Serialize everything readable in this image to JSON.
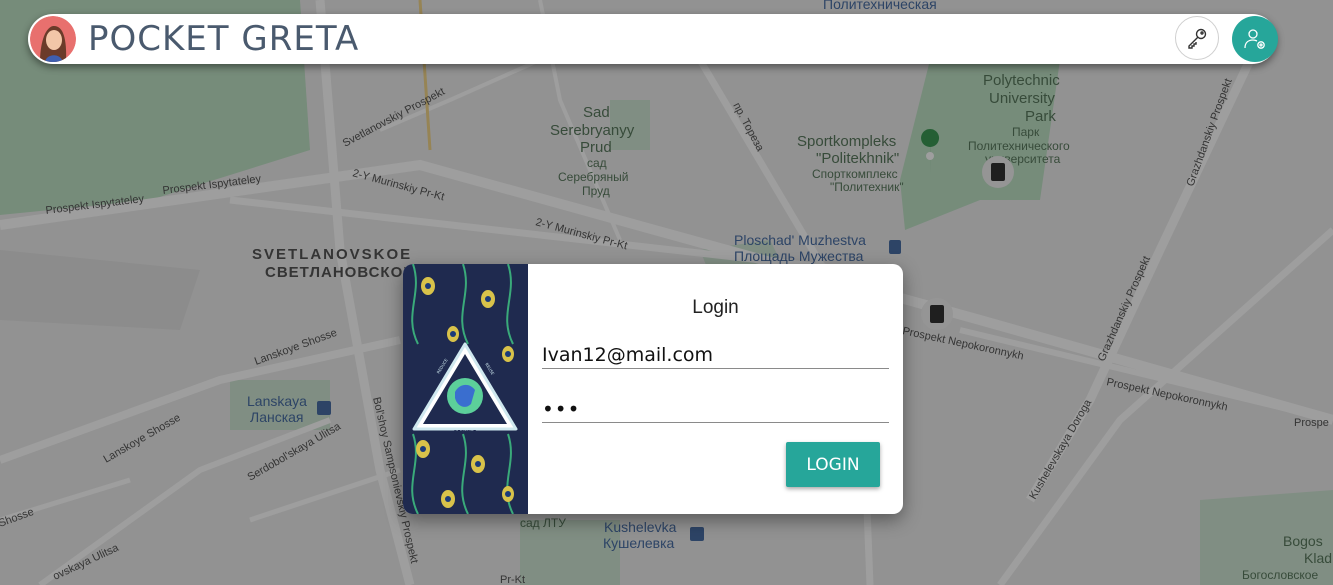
{
  "app": {
    "title": "POCKET GRETA"
  },
  "topbar": {
    "avatar_icon": "user-avatar",
    "key_icon": "key-icon",
    "user_icon": "user-settings-icon",
    "accent": "#26a69a"
  },
  "map": {
    "labels": [
      "Политехническая",
      "Polytechnic",
      "University",
      "Park",
      "Парк",
      "Политехнического",
      "университета",
      "Sad",
      "Serebryanyy",
      "Prud",
      "сад",
      "Серебряный",
      "Пруд",
      "Sportkompleks",
      "\"Politekhnik\"",
      "Спорткомплекс",
      "\"Политехник\"",
      "SVETLANOVSKOE",
      "СВЕТЛАНОВСКОЕ",
      "Prospekt Ispytateley",
      "Prospekt Ispytateley",
      "Svetlanovskiy Prospekt",
      "2-Y Murinskiy Pr-Kt",
      "2-Y Murinskiy Pr-Kt",
      "пр. Тореза",
      "Ploschad' Muzhestva",
      "Площадь Мужества",
      "Lanskoye Shosse",
      "Lanskoye Shosse",
      "Lanskaya",
      "Ланская",
      "Serdobol'skaya Ulitsa",
      "Bol'shoy Sampsonievskiy Prospekt",
      "Shosse",
      "ovskaya Ulitsa",
      "Prospekt Nepokoronnykh",
      "Prospekt Nepokoronnykh",
      "Prospe",
      "Grazhdanskiy Prospekt",
      "Grazhdanskiy Prospekt",
      "Kushelevskaya Doroga",
      "Kushelevka",
      "Кушелевка",
      "сад ЛТУ",
      "Pr-Kt",
      "Bogos",
      "Klad",
      "Богословское"
    ]
  },
  "login": {
    "title": "Login",
    "email": "Ivan12@mail.com",
    "password_mask": "•••",
    "button": "LOGIN",
    "art_caption": "RECYCLE",
    "art_top_left": "REDUCE",
    "art_top_right": "REUSE"
  }
}
